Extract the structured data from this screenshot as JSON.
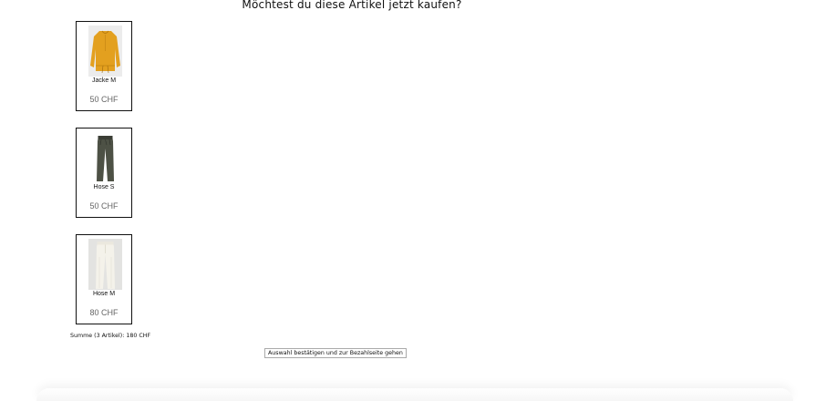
{
  "question": "Möchtest du diese Artikel jetzt kaufen?",
  "items": [
    {
      "name": "Jacke M",
      "price": "50 CHF",
      "image_icon": "orange-blouse-image",
      "color": "#e3a01f"
    },
    {
      "name": "Hose S",
      "price": "50 CHF",
      "image_icon": "dark-green-trousers-image",
      "color": "#4d5145"
    },
    {
      "name": "Hose M",
      "price": "80 CHF",
      "image_icon": "white-trousers-image",
      "color": "#eeece2"
    }
  ],
  "summary": "Summe (3 Artikel): 180 CHF",
  "confirm_button": "Auswahl bestätigen und zur Bezahlseite gehen"
}
